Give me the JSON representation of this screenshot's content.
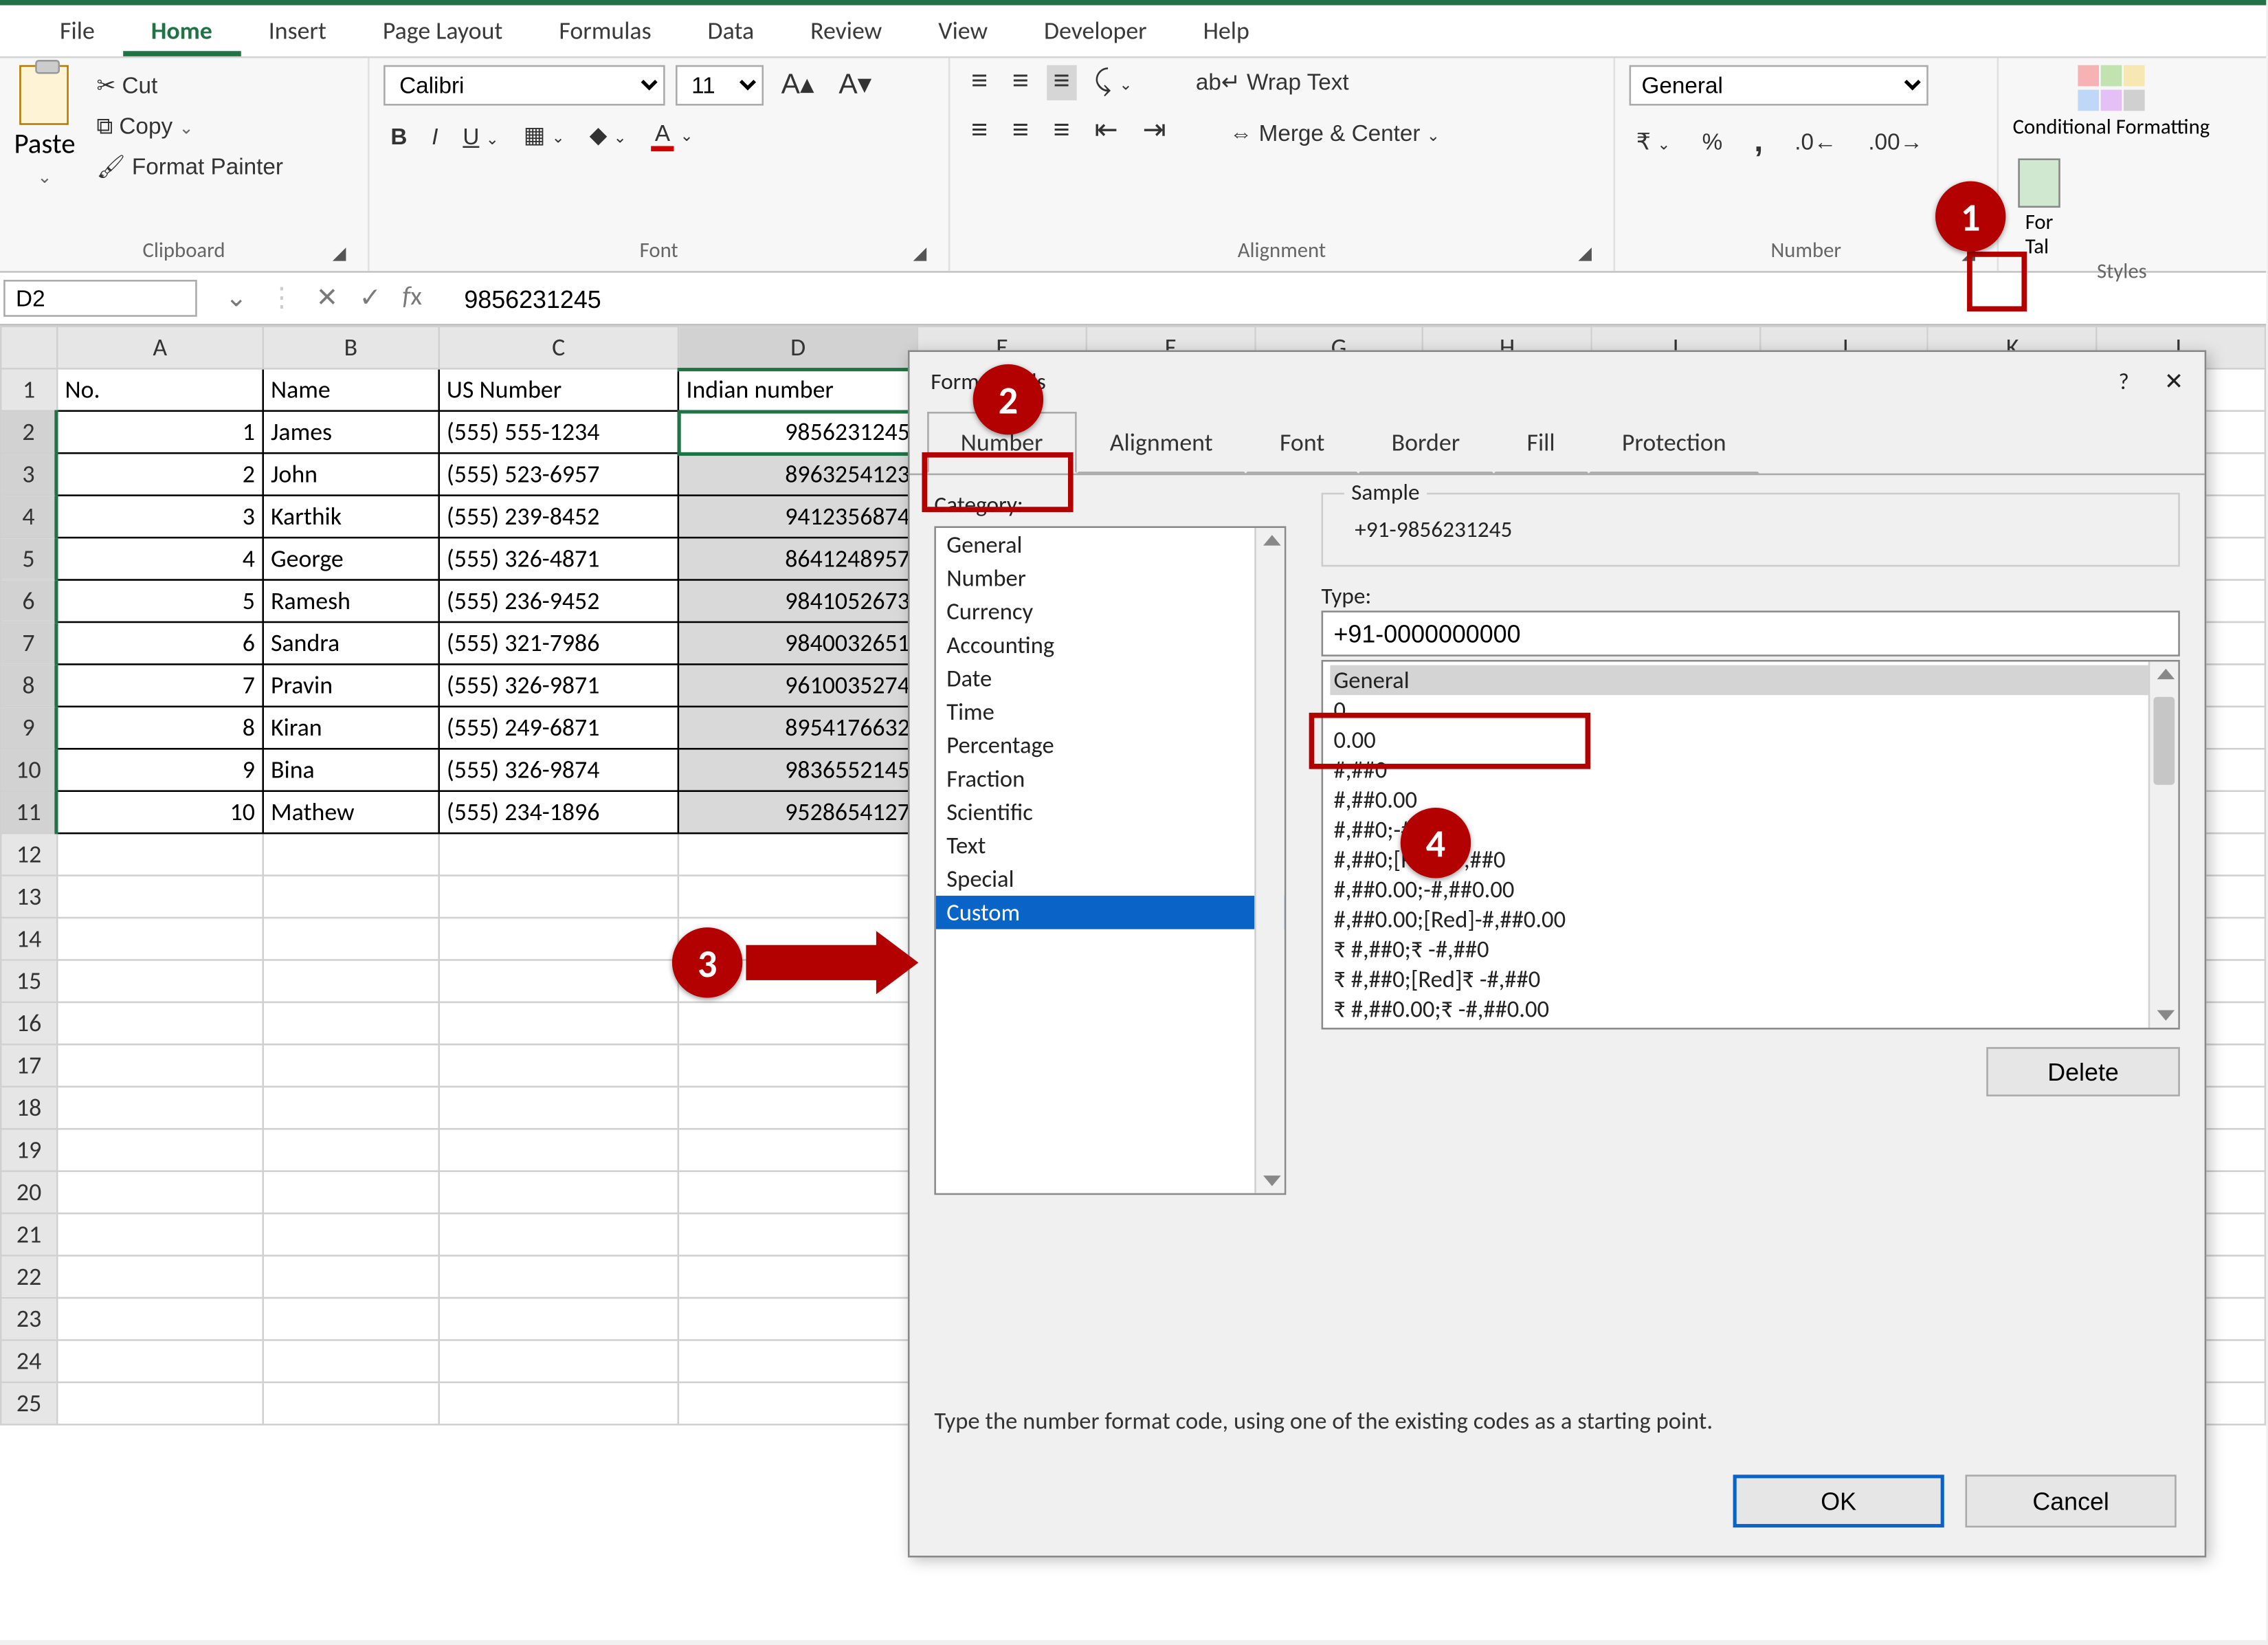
{
  "tabs": {
    "file": "File",
    "home": "Home",
    "insert": "Insert",
    "page_layout": "Page Layout",
    "formulas": "Formulas",
    "data": "Data",
    "review": "Review",
    "view": "View",
    "developer": "Developer",
    "help": "Help"
  },
  "ribbon": {
    "clipboard": {
      "paste": "Paste",
      "cut": "Cut",
      "copy": "Copy",
      "format_painter": "Format Painter",
      "group": "Clipboard"
    },
    "font": {
      "name": "Calibri",
      "size": "11",
      "group": "Font"
    },
    "alignment": {
      "wrap": "Wrap Text",
      "merge": "Merge & Center",
      "group": "Alignment"
    },
    "number": {
      "format": "General",
      "group": "Number",
      "pct": "%",
      "comma": ","
    },
    "styles": {
      "cond_fmt": "Conditional Formatting",
      "fmt_table": "Format as Table",
      "group": "Styles"
    }
  },
  "namebox": "D2",
  "formula_value": "9856231245",
  "columns": [
    "A",
    "B",
    "C",
    "D",
    "E",
    "F",
    "G",
    "H",
    "I",
    "J",
    "K",
    "L"
  ],
  "headers": {
    "no": "No.",
    "name": "Name",
    "us": "US Number",
    "in": "Indian number"
  },
  "rows": [
    {
      "no": "1",
      "name": "James",
      "us": "(555) 555-1234",
      "in": "9856231245"
    },
    {
      "no": "2",
      "name": "John",
      "us": "(555) 523-6957",
      "in": "8963254123"
    },
    {
      "no": "3",
      "name": "Karthik",
      "us": "(555) 239-8452",
      "in": "9412356874"
    },
    {
      "no": "4",
      "name": "George",
      "us": "(555) 326-4871",
      "in": "8641248957"
    },
    {
      "no": "5",
      "name": "Ramesh",
      "us": "(555) 236-9452",
      "in": "9841052673"
    },
    {
      "no": "6",
      "name": "Sandra",
      "us": "(555) 321-7986",
      "in": "9840032651"
    },
    {
      "no": "7",
      "name": "Pravin",
      "us": "(555) 326-9871",
      "in": "9610035274"
    },
    {
      "no": "8",
      "name": "Kiran",
      "us": "(555) 249-6871",
      "in": "8954176632"
    },
    {
      "no": "9",
      "name": "Bina",
      "us": "(555) 326-9874",
      "in": "9836552145"
    },
    {
      "no": "10",
      "name": "Mathew",
      "us": "(555) 234-1896",
      "in": "9528654127"
    }
  ],
  "dialog": {
    "title": "Format Cells",
    "tabs": {
      "number": "Number",
      "alignment": "Alignment",
      "font": "Font",
      "border": "Border",
      "fill": "Fill",
      "protection": "Protection"
    },
    "category_label": "Category:",
    "categories": [
      "General",
      "Number",
      "Currency",
      "Accounting",
      "Date",
      "Time",
      "Percentage",
      "Fraction",
      "Scientific",
      "Text",
      "Special",
      "Custom"
    ],
    "sample_label": "Sample",
    "sample_value": "+91-9856231245",
    "type_label": "Type:",
    "type_value": "+91-0000000000",
    "formats": [
      "General",
      "0",
      "0.00",
      "#,##0",
      "#,##0.00",
      "#,##0;-#,##0",
      "#,##0;[Red]-#,##0",
      "#,##0.00;-#,##0.00",
      "#,##0.00;[Red]-#,##0.00",
      "₹ #,##0;₹ -#,##0",
      "₹ #,##0;[Red]₹ -#,##0",
      "₹ #,##0.00;₹ -#,##0.00"
    ],
    "delete": "Delete",
    "help_text": "Type the number format code, using one of the existing codes as a starting point.",
    "ok": "OK",
    "cancel": "Cancel",
    "help_icon": "?",
    "close_icon": "✕"
  },
  "callouts": {
    "1": "1",
    "2": "2",
    "3": "3",
    "4": "4"
  }
}
